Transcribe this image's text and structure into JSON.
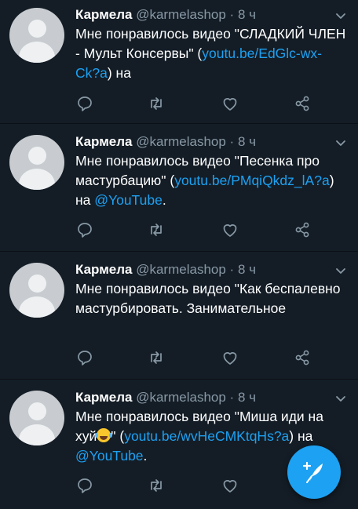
{
  "colors": {
    "background": "#141d26",
    "divider": "#0b1016",
    "link": "#1da1f2",
    "muted": "#8899a6",
    "fab": "#1da1f2"
  },
  "icons": [
    "chevron-down-icon",
    "reply-icon",
    "retweet-icon",
    "like-icon",
    "share-icon",
    "compose-tweet-icon",
    "default-avatar-icon",
    "joy-emoji-icon"
  ],
  "tweets": [
    {
      "name": "Кармела",
      "handle": "@karmelashop",
      "dot": "·",
      "time": "8 ч",
      "text_before": "Мне понравилось видео \"СЛАДКИЙ ЧЛЕН - Мульт Консервы\" (",
      "link": "youtu.be/EdGlc-wx-Ck?a",
      "text_after": ") на"
    },
    {
      "name": "Кармела",
      "handle": "@karmelashop",
      "dot": "·",
      "time": "8 ч",
      "text_before": "Мне понравилось видео \"Песенка про мастурбацию\" (",
      "link": "youtu.be/PMqiQkdz_lA?a",
      "text_middle": ") на ",
      "mention": "@YouTube",
      "text_after": "."
    },
    {
      "name": "Кармела",
      "handle": "@karmelashop",
      "dot": "·",
      "time": "8 ч",
      "text_before": "Мне понравилось видео \"Как беспалевно мастурбировать. Занимательное"
    },
    {
      "name": "Кармела",
      "handle": "@karmelashop",
      "dot": "·",
      "time": "8 ч",
      "text_before": "Мне понравилось видео \"Миша иди на хуй",
      "text_quote": "\" (",
      "link": "youtu.be/wvHeCMKtqHs?a",
      "text_middle": ") на ",
      "mention": "@YouTube",
      "text_after": "."
    }
  ]
}
